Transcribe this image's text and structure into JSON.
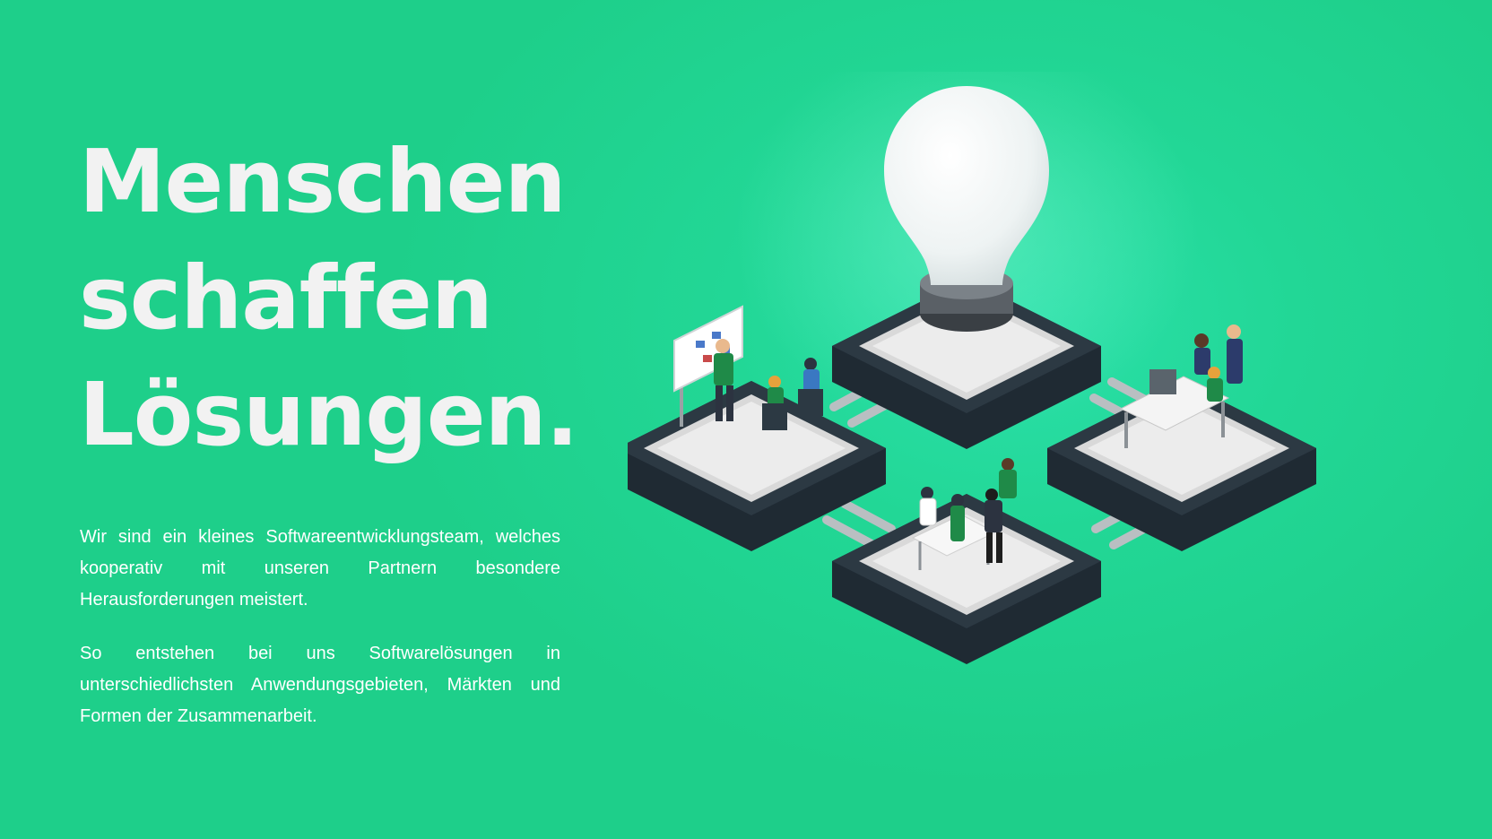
{
  "hero": {
    "headline": [
      "Menschen",
      "schaffen",
      "Lösungen."
    ],
    "paragraphs": [
      "Wir sind ein kleines Softwareentwicklungsteam, welches kooperativ mit unseren Partnern besondere Herausforderungen meistert.",
      "So entstehen bei uns Softwarelösungen in unterschiedlichsten Anwendungsgebieten, Märkten und Formen der Zusammenarbeit."
    ]
  },
  "colors": {
    "background": "#22d796",
    "headline": "#f2f2f2",
    "platform_dark": "#233039",
    "platform_light": "#e4e4e4"
  },
  "illustration": {
    "icons": [
      "light-bulb-icon",
      "whiteboard-icon",
      "desk-computer-icon",
      "meeting-table-icon"
    ]
  }
}
